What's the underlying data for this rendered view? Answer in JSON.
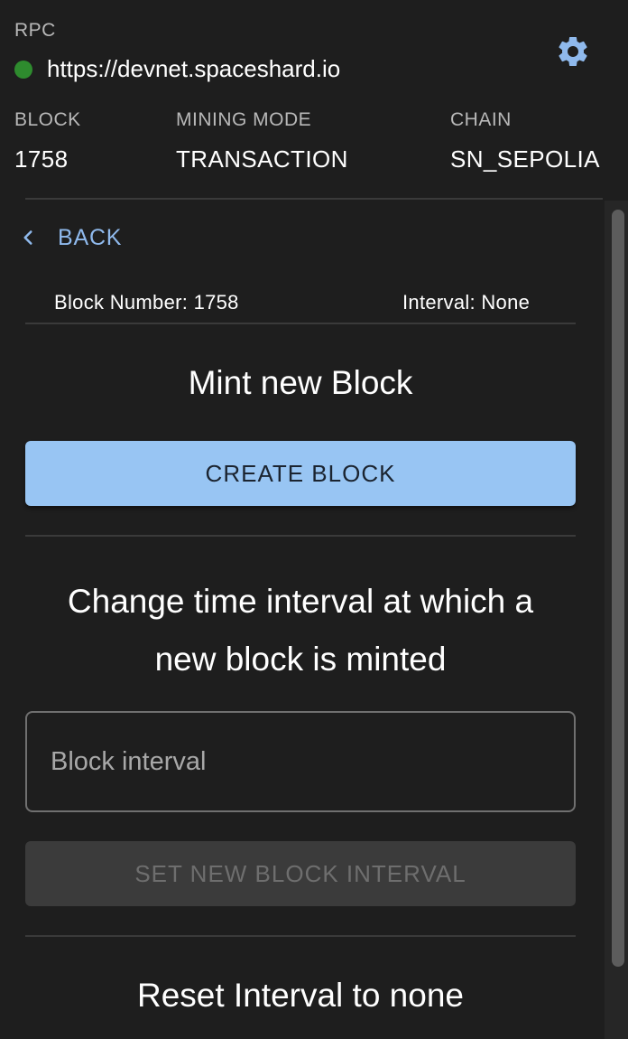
{
  "header": {
    "rpc_label": "RPC",
    "rpc_url": "https://devnet.spaceshard.io",
    "status_color": "#2e8b2e",
    "settings_icon": "gear-icon",
    "stats": [
      {
        "label": "BLOCK",
        "value": "1758"
      },
      {
        "label": "MINING MODE",
        "value": "TRANSACTION"
      },
      {
        "label": "CHAIN",
        "value": "SN_SEPOLIA"
      }
    ]
  },
  "nav": {
    "back_label": "BACK",
    "back_icon": "chevron-left-icon"
  },
  "info": {
    "block_number": "Block Number: 1758",
    "interval": "Interval: None"
  },
  "mint": {
    "title": "Mint new Block",
    "button_label": "CREATE BLOCK"
  },
  "interval_section": {
    "title_line1": "Change time interval at which a",
    "title_line2": "new block is minted",
    "input_placeholder": "Block interval",
    "input_value": "",
    "button_label": "SET NEW BLOCK INTERVAL"
  },
  "reset": {
    "title": "Reset Interval to none"
  },
  "colors": {
    "accent": "#98c5f3",
    "link": "#8fb9ec",
    "background": "#1e1e1e"
  }
}
